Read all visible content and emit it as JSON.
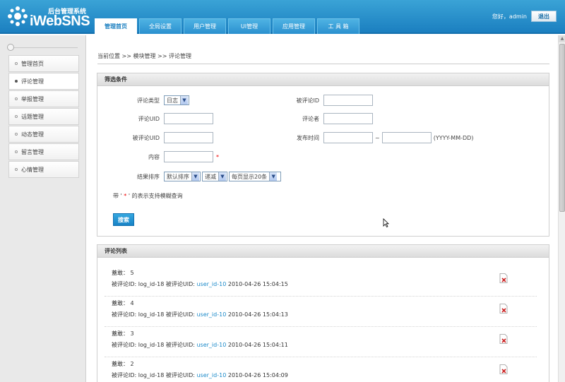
{
  "app": {
    "subtitle": "后台管理系统",
    "name": "iWebSNS"
  },
  "nav": {
    "tabs": [
      {
        "label": "管理首页"
      },
      {
        "label": "全局设置"
      },
      {
        "label": "用户管理"
      },
      {
        "label": "UI管理"
      },
      {
        "label": "应用管理"
      },
      {
        "label": "工 具 箱"
      }
    ]
  },
  "user": {
    "greeting": "您好，admin",
    "logout": "退出"
  },
  "sidebar": {
    "items": [
      {
        "label": "管理首页"
      },
      {
        "label": "评论管理"
      },
      {
        "label": "举报管理"
      },
      {
        "label": "话题管理"
      },
      {
        "label": "动态管理"
      },
      {
        "label": "留言管理"
      },
      {
        "label": "心情管理"
      }
    ]
  },
  "breadcrumb": {
    "text": "当前位置 >> 模块管理 >> 评论管理"
  },
  "filter": {
    "title": "筛选条件",
    "comment_type_label": "评论类型",
    "comment_type_value": "日志",
    "target_id_label": "被评论ID",
    "comment_uid_label": "评论UID",
    "commenter_label": "评论者",
    "target_uid_label": "被评论UID",
    "time_label": "发布时间",
    "time_sep": "~",
    "time_format": "(YYYY-MM-DD)",
    "content_label": "内容",
    "content_req": "*",
    "sort_label": "结果排序",
    "sort_value": "默认排序",
    "order_value": "递减",
    "perpage_value": "每页显示20条",
    "hint_pre": "带 '",
    "hint_star": " * ",
    "hint_post": "' 的表示支持模糊查询",
    "search_button": "搜索"
  },
  "list": {
    "title": "评论列表",
    "items": [
      {
        "line1": "蓋敢： 5",
        "prefix": "被评论ID: log_id-18 被评论UID: ",
        "link": "user_id-10",
        "time": " 2010-04-26 15:04:15"
      },
      {
        "line1": "蓋敢： 4",
        "prefix": "被评论ID: log_id-18 被评论UID: ",
        "link": "user_id-10",
        "time": " 2010-04-26 15:04:13"
      },
      {
        "line1": "蓋敢： 3",
        "prefix": "被评论ID: log_id-18 被评论UID: ",
        "link": "user_id-10",
        "time": " 2010-04-26 15:04:11"
      },
      {
        "line1": "蓋敢： 2",
        "prefix": "被评论ID: log_id-18 被评论UID: ",
        "link": "user_id-10",
        "time": " 2010-04-26 15:04:09"
      }
    ]
  },
  "colors": {
    "header": "#1b7fc0",
    "link": "#1a89c9",
    "required": "#ee0000"
  }
}
